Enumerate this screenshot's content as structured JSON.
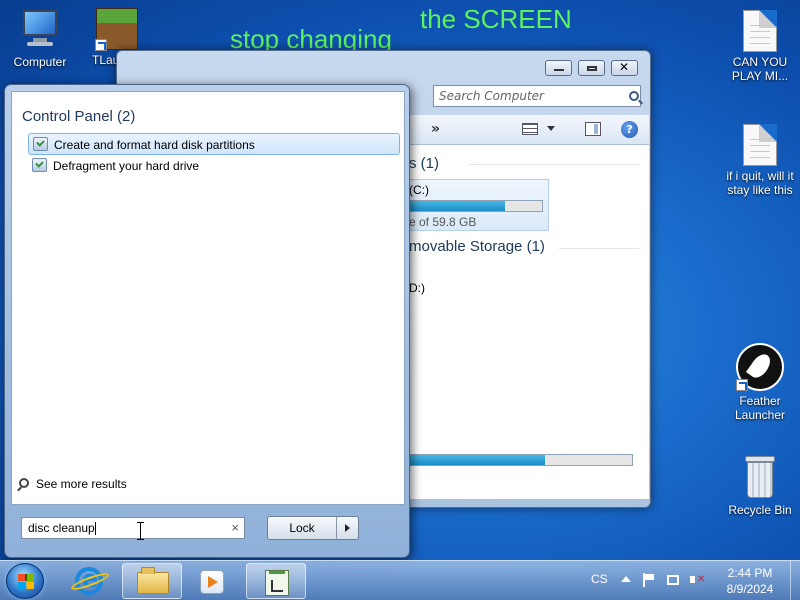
{
  "wallpaper": {
    "text_1": "the SCREEN",
    "text_2": "stop changing"
  },
  "desktop": {
    "computer": "Computer",
    "tlauncher": "TLau",
    "file_1": "CAN YOU PLAY MI...",
    "file_2": "if i quit, will it stay like this",
    "feather": "Feather Launcher",
    "recycle_bin": "Recycle Bin"
  },
  "explorer": {
    "search_placeholder": "Search Computer",
    "more_chevron": "»",
    "help": "?",
    "group_hdd": "s (1)",
    "drive_c_label": "(C:)",
    "drive_c_space": "e of 59.8 GB",
    "drive_c_fill": 0.72,
    "group_removable": "movable Storage (1)",
    "drive_d_label": "D:)",
    "bottom_bar_fill": 0.61
  },
  "start_menu": {
    "results_heading": "Control Panel (2)",
    "results": [
      "Create and format hard disk partitions",
      "Defragment your hard drive"
    ],
    "see_more": "See more results",
    "search_value": "disc cleanup",
    "search_clear": "×",
    "lock_label": "Lock"
  },
  "taskbar": {
    "language": "CS",
    "time": "2:44 PM",
    "date": "8/9/2024"
  },
  "colors": {
    "wallpaper_text": "#5ef25e",
    "wallpaper_blue": "#1a6ccc",
    "selection": "#cfe5fb"
  }
}
